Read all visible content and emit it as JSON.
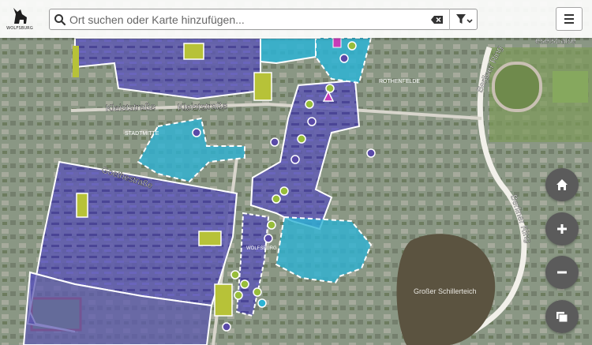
{
  "app": {
    "logo_text": "WOLFSBURG"
  },
  "search": {
    "placeholder": "Ort suchen oder Karte hinzufügen...",
    "value": ""
  },
  "map": {
    "labels": {
      "kleiststrasse_1": "Kleiststraße",
      "kleiststrasse_2": "Kleiststraße",
      "goethestrasse": "Goethestraße",
      "stadtmitte": "STADTMITTE",
      "rothenfelde": "ROTHENFELDE",
      "wolfsburg": "WOLFSBURG",
      "berliner_ring_1": "Berliner Ring",
      "berliner_ring_2": "Berliner Ring",
      "schillerteich": "Großer Schillerteich",
      "top_right_street": "eselstraße"
    },
    "colors": {
      "purple_area": "#5e59b0",
      "cyan_area": "#2db3d4",
      "olive_area": "#b7c238",
      "marker_purple": "#5a4aa8",
      "marker_green": "#97bd3a",
      "marker_pink": "#c83bb8",
      "water": "#5b5340"
    }
  },
  "controls": {
    "home": "home-icon",
    "zoom_in": "plus-icon",
    "zoom_out": "minus-icon",
    "layers": "layers-icon"
  }
}
